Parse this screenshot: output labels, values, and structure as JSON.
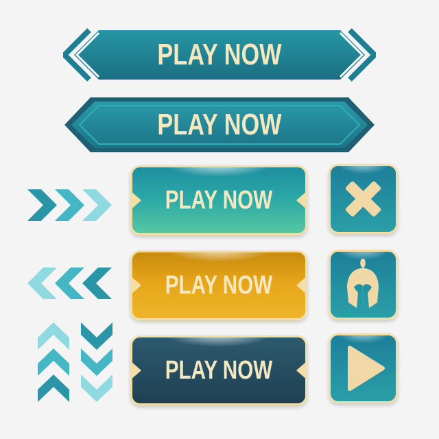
{
  "banners": [
    {
      "label": "PLAY NOW"
    },
    {
      "label": "PLAY NOW"
    }
  ],
  "buttons": [
    {
      "label": "PLAY NOW",
      "style": "teal"
    },
    {
      "label": "PLAY NOW",
      "style": "gold"
    },
    {
      "label": "PLAY NOW",
      "style": "dark"
    }
  ],
  "icon_buttons": [
    {
      "icon": "close-icon"
    },
    {
      "icon": "spartan-helmet-icon"
    },
    {
      "icon": "play-icon"
    }
  ],
  "arrow_sets": [
    {
      "direction": "right"
    },
    {
      "direction": "left"
    },
    {
      "direction": "up"
    },
    {
      "direction": "down"
    }
  ],
  "colors": {
    "teal_dark": "#1d6f82",
    "teal": "#2a9fa8",
    "cream": "#f5e8c0",
    "gold": "#e6a51a",
    "navy": "#264d60",
    "arrow_light": "#8fd9e1",
    "arrow_mid": "#45b7c4",
    "arrow_dark": "#2a95a6"
  }
}
